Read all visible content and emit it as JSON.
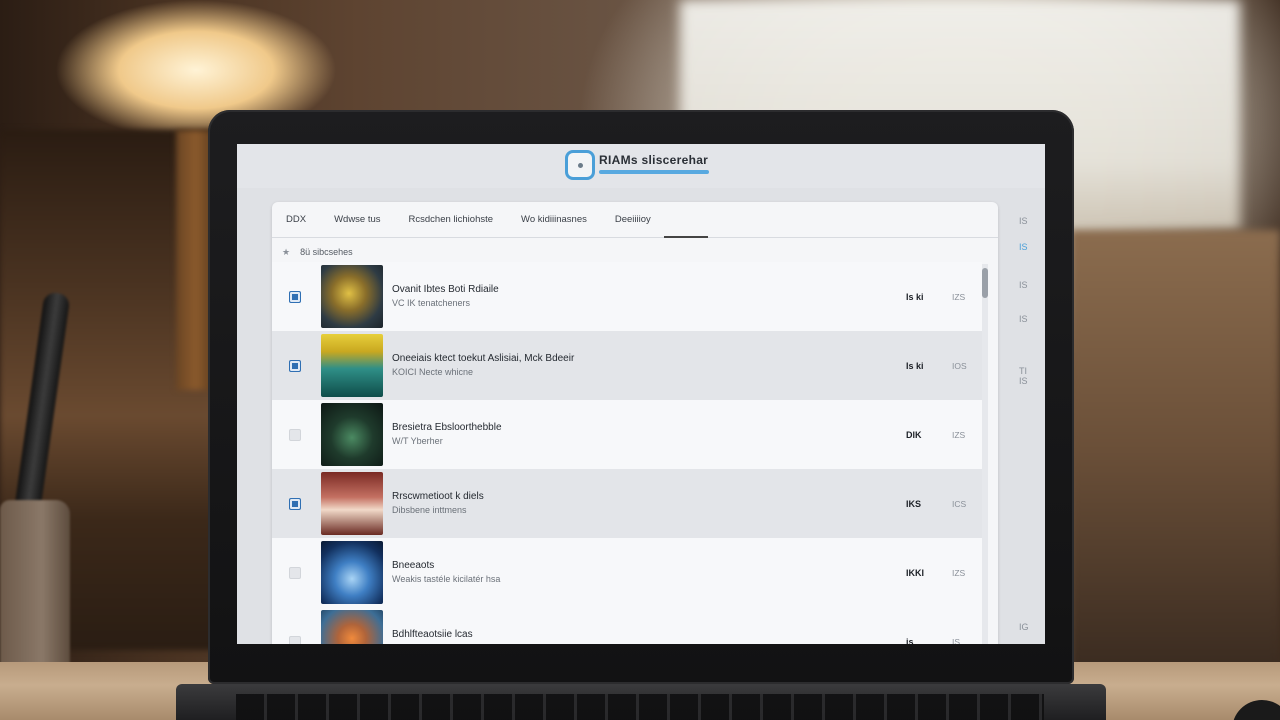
{
  "app": {
    "title": "RIAMs sliscerehar"
  },
  "tabs": [
    {
      "label": "DDX"
    },
    {
      "label": "Wdwse tus"
    },
    {
      "label": "Rcsdchen lichiohste"
    },
    {
      "label": "Wo kidiiinasnes"
    },
    {
      "label": "Deeiiiioy"
    }
  ],
  "filter": {
    "star": "★",
    "label": "8ü sibcsehes"
  },
  "rows": [
    {
      "title": "Ovanit Ibtes Boti Rdiaile",
      "sub": "VC IK tenatcheners",
      "num": "Is ki",
      "meta": "IZS",
      "checked": true
    },
    {
      "title": "Oneeiais ktect toekut Aslisiai, Mck Bdeeir",
      "sub": "KOICI Necte whicne",
      "num": "Is ki",
      "meta": "IOS",
      "checked": true
    },
    {
      "title": "Bresietra Ebsloorthebble",
      "sub": "W/T Yberher",
      "num": "DIK",
      "meta": "IZS",
      "checked": false
    },
    {
      "title": "Rrscwmetioot k diels",
      "sub": "Dibsbene inttmens",
      "num": "IKS",
      "meta": "ICS",
      "checked": true
    },
    {
      "title": "Bneeaots",
      "sub": "Weakis tastéle kicilatér hsa",
      "num": "IKKI",
      "meta": "IZS",
      "checked": false
    },
    {
      "title": "Bdhlfteaotsiie lcas",
      "sub": "",
      "num": "is",
      "meta": "IS",
      "checked": false
    }
  ],
  "rail": [
    "IS",
    "IS",
    "IS",
    "IS",
    "TI IS",
    "IG"
  ]
}
